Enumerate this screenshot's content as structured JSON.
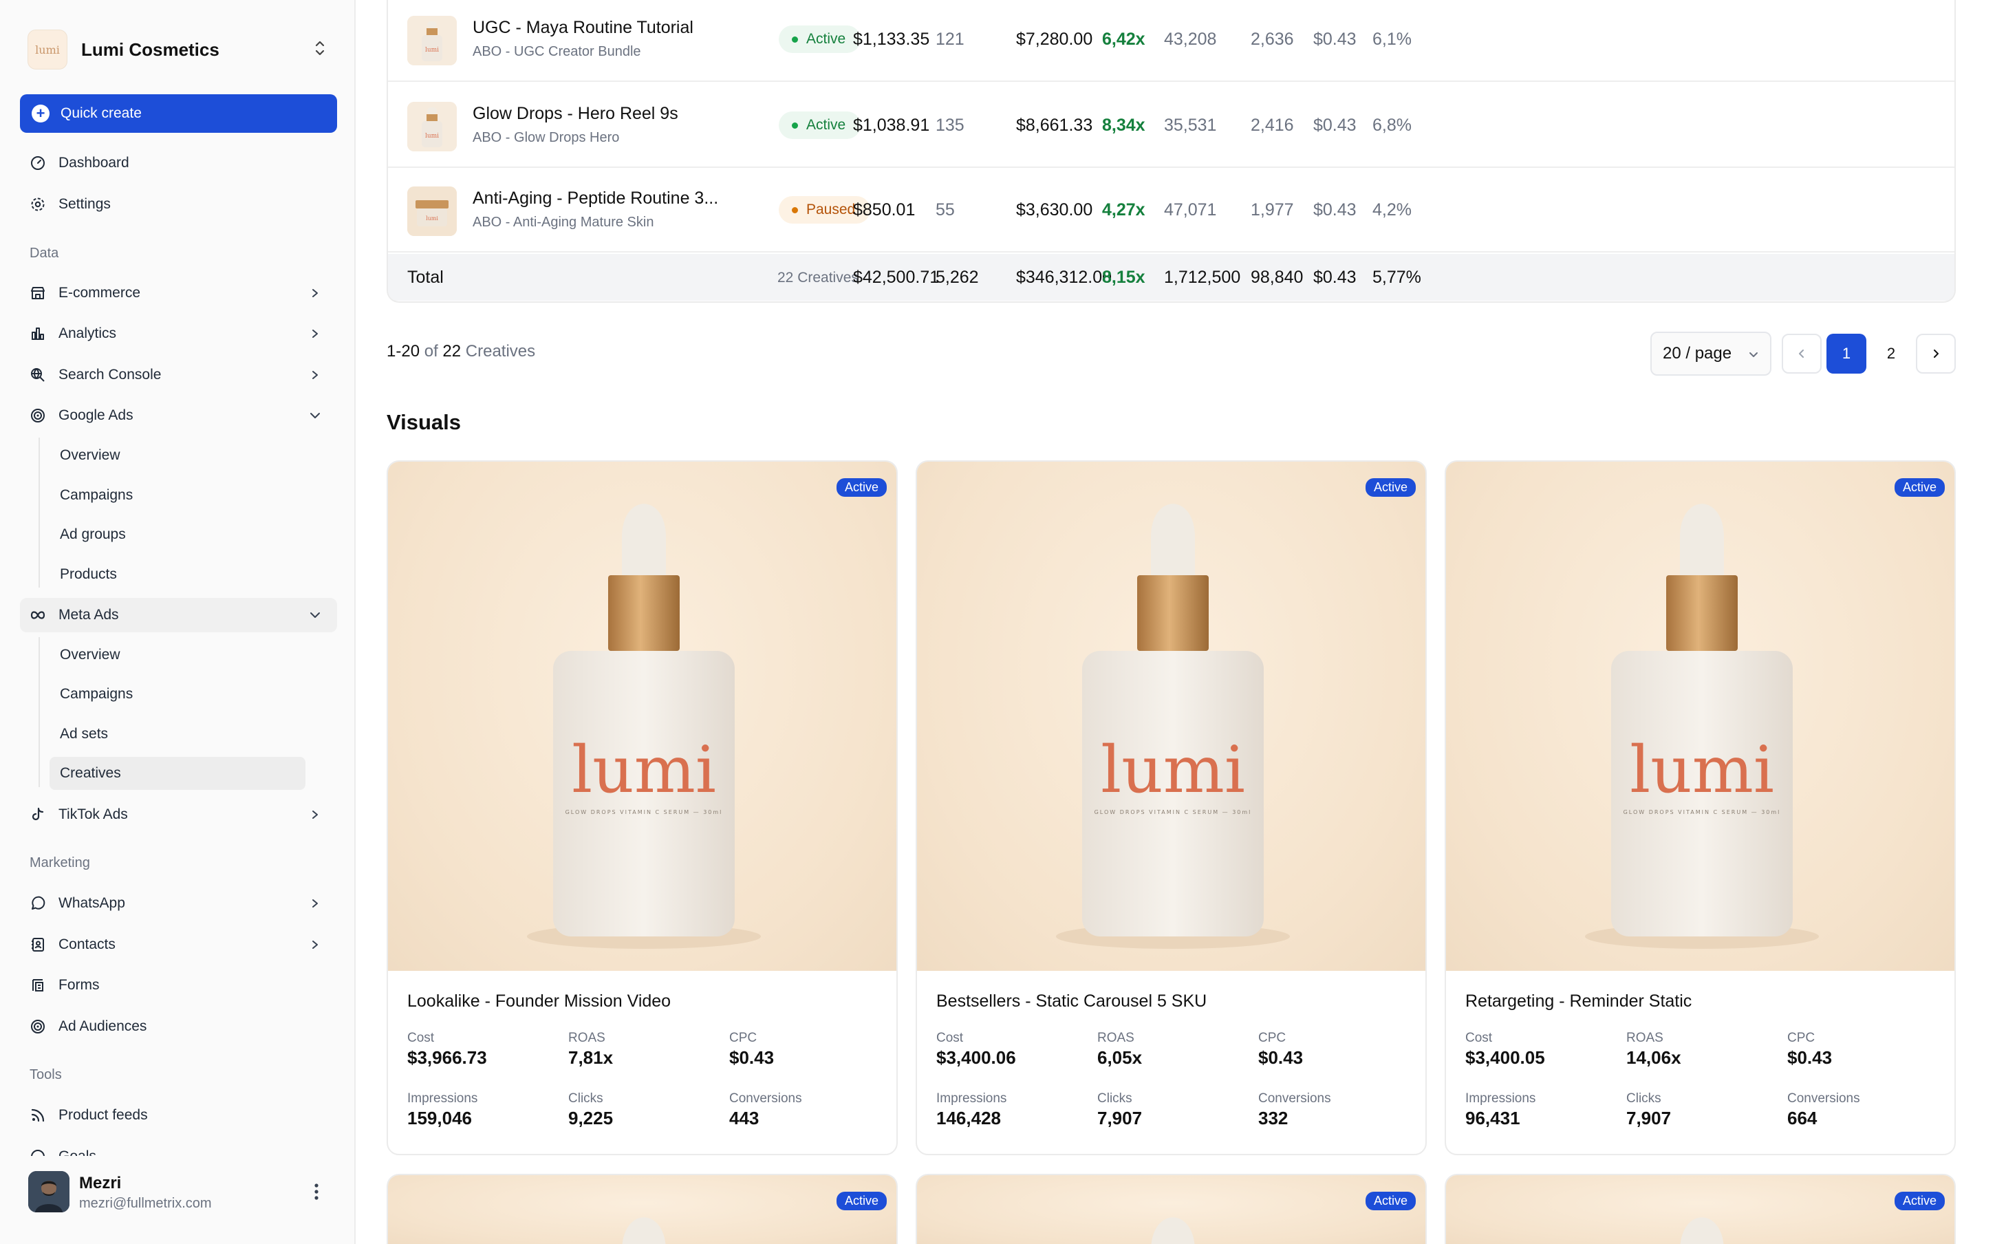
{
  "brand": {
    "name": "Lumi Cosmetics",
    "logo_text": "lumi"
  },
  "quick_create": "Quick create",
  "nav": {
    "dashboard": "Dashboard",
    "settings": "Settings",
    "section_data": "Data",
    "ecommerce": "E-commerce",
    "analytics": "Analytics",
    "search_console": "Search Console",
    "google_ads": "Google Ads",
    "google_sub": [
      "Overview",
      "Campaigns",
      "Ad groups",
      "Products"
    ],
    "meta_ads": "Meta Ads",
    "meta_sub": [
      "Overview",
      "Campaigns",
      "Ad sets",
      "Creatives"
    ],
    "tiktok_ads": "TikTok Ads",
    "section_marketing": "Marketing",
    "whatsapp": "WhatsApp",
    "contacts": "Contacts",
    "forms": "Forms",
    "ad_audiences": "Ad Audiences",
    "section_tools": "Tools",
    "product_feeds": "Product feeds",
    "goals": "Goals"
  },
  "user": {
    "name": "Mezri",
    "email": "mezri@fullmetrix.com"
  },
  "table": {
    "rows": [
      {
        "name": "UGC - Maya Routine Tutorial",
        "sub": "ABO - UGC Creator Bundle",
        "status": "Active",
        "cost": "$1,133.35",
        "purchases": "121",
        "revenue": "$7,280.00",
        "roas": "6,42x",
        "impressions": "43,208",
        "clicks": "2,636",
        "cpc": "$0.43",
        "ctr": "6,1%"
      },
      {
        "name": "Glow Drops - Hero Reel 9s",
        "sub": "ABO - Glow Drops Hero",
        "status": "Active",
        "cost": "$1,038.91",
        "purchases": "135",
        "revenue": "$8,661.33",
        "roas": "8,34x",
        "impressions": "35,531",
        "clicks": "2,416",
        "cpc": "$0.43",
        "ctr": "6,8%"
      },
      {
        "name": "Anti-Aging - Peptide Routine 3...",
        "sub": "ABO - Anti-Aging Mature Skin",
        "status": "Paused",
        "cost": "$850.01",
        "purchases": "55",
        "revenue": "$3,630.00",
        "roas": "4,27x",
        "impressions": "47,071",
        "clicks": "1,977",
        "cpc": "$0.43",
        "ctr": "4,2%"
      }
    ],
    "total": {
      "label": "Total",
      "count": "22 Creatives",
      "cost": "$42,500.71",
      "purchases": "5,262",
      "revenue": "$346,312.00",
      "roas": "8,15x",
      "impressions": "1,712,500",
      "clicks": "98,840",
      "cpc": "$0.43",
      "ctr": "5,77%"
    }
  },
  "pagination": {
    "range": "1-20",
    "of": "of",
    "total": "22",
    "unit": "Creatives",
    "per_page": "20 / page",
    "pages": [
      "1",
      "2"
    ],
    "current": "1"
  },
  "visuals": {
    "title": "Visuals",
    "label_lumi": "lumi",
    "label_sub": "GLOW DROPS VITAMIN C SERUM — 30ml",
    "metric_labels": {
      "cost": "Cost",
      "roas": "ROAS",
      "cpc": "CPC",
      "impressions": "Impressions",
      "clicks": "Clicks",
      "conversions": "Conversions"
    },
    "cards": [
      {
        "status": "Active",
        "title": "Lookalike - Founder Mission Video",
        "cost": "$3,966.73",
        "roas": "7,81x",
        "cpc": "$0.43",
        "impressions": "159,046",
        "clicks": "9,225",
        "conversions": "443"
      },
      {
        "status": "Active",
        "title": "Bestsellers - Static Carousel 5 SKU",
        "cost": "$3,400.06",
        "roas": "6,05x",
        "cpc": "$0.43",
        "impressions": "146,428",
        "clicks": "7,907",
        "conversions": "332"
      },
      {
        "status": "Active",
        "title": "Retargeting - Reminder Static",
        "cost": "$3,400.05",
        "roas": "14,06x",
        "cpc": "$0.43",
        "impressions": "96,431",
        "clicks": "7,907",
        "conversions": "664"
      },
      {
        "status": "Active"
      },
      {
        "status": "Active"
      },
      {
        "status": "Active"
      }
    ]
  },
  "colors": {
    "accent": "#1d4ed8",
    "active_green": "#15803d",
    "paused_amber": "#b45309",
    "bottle_label": "#d9704f"
  }
}
